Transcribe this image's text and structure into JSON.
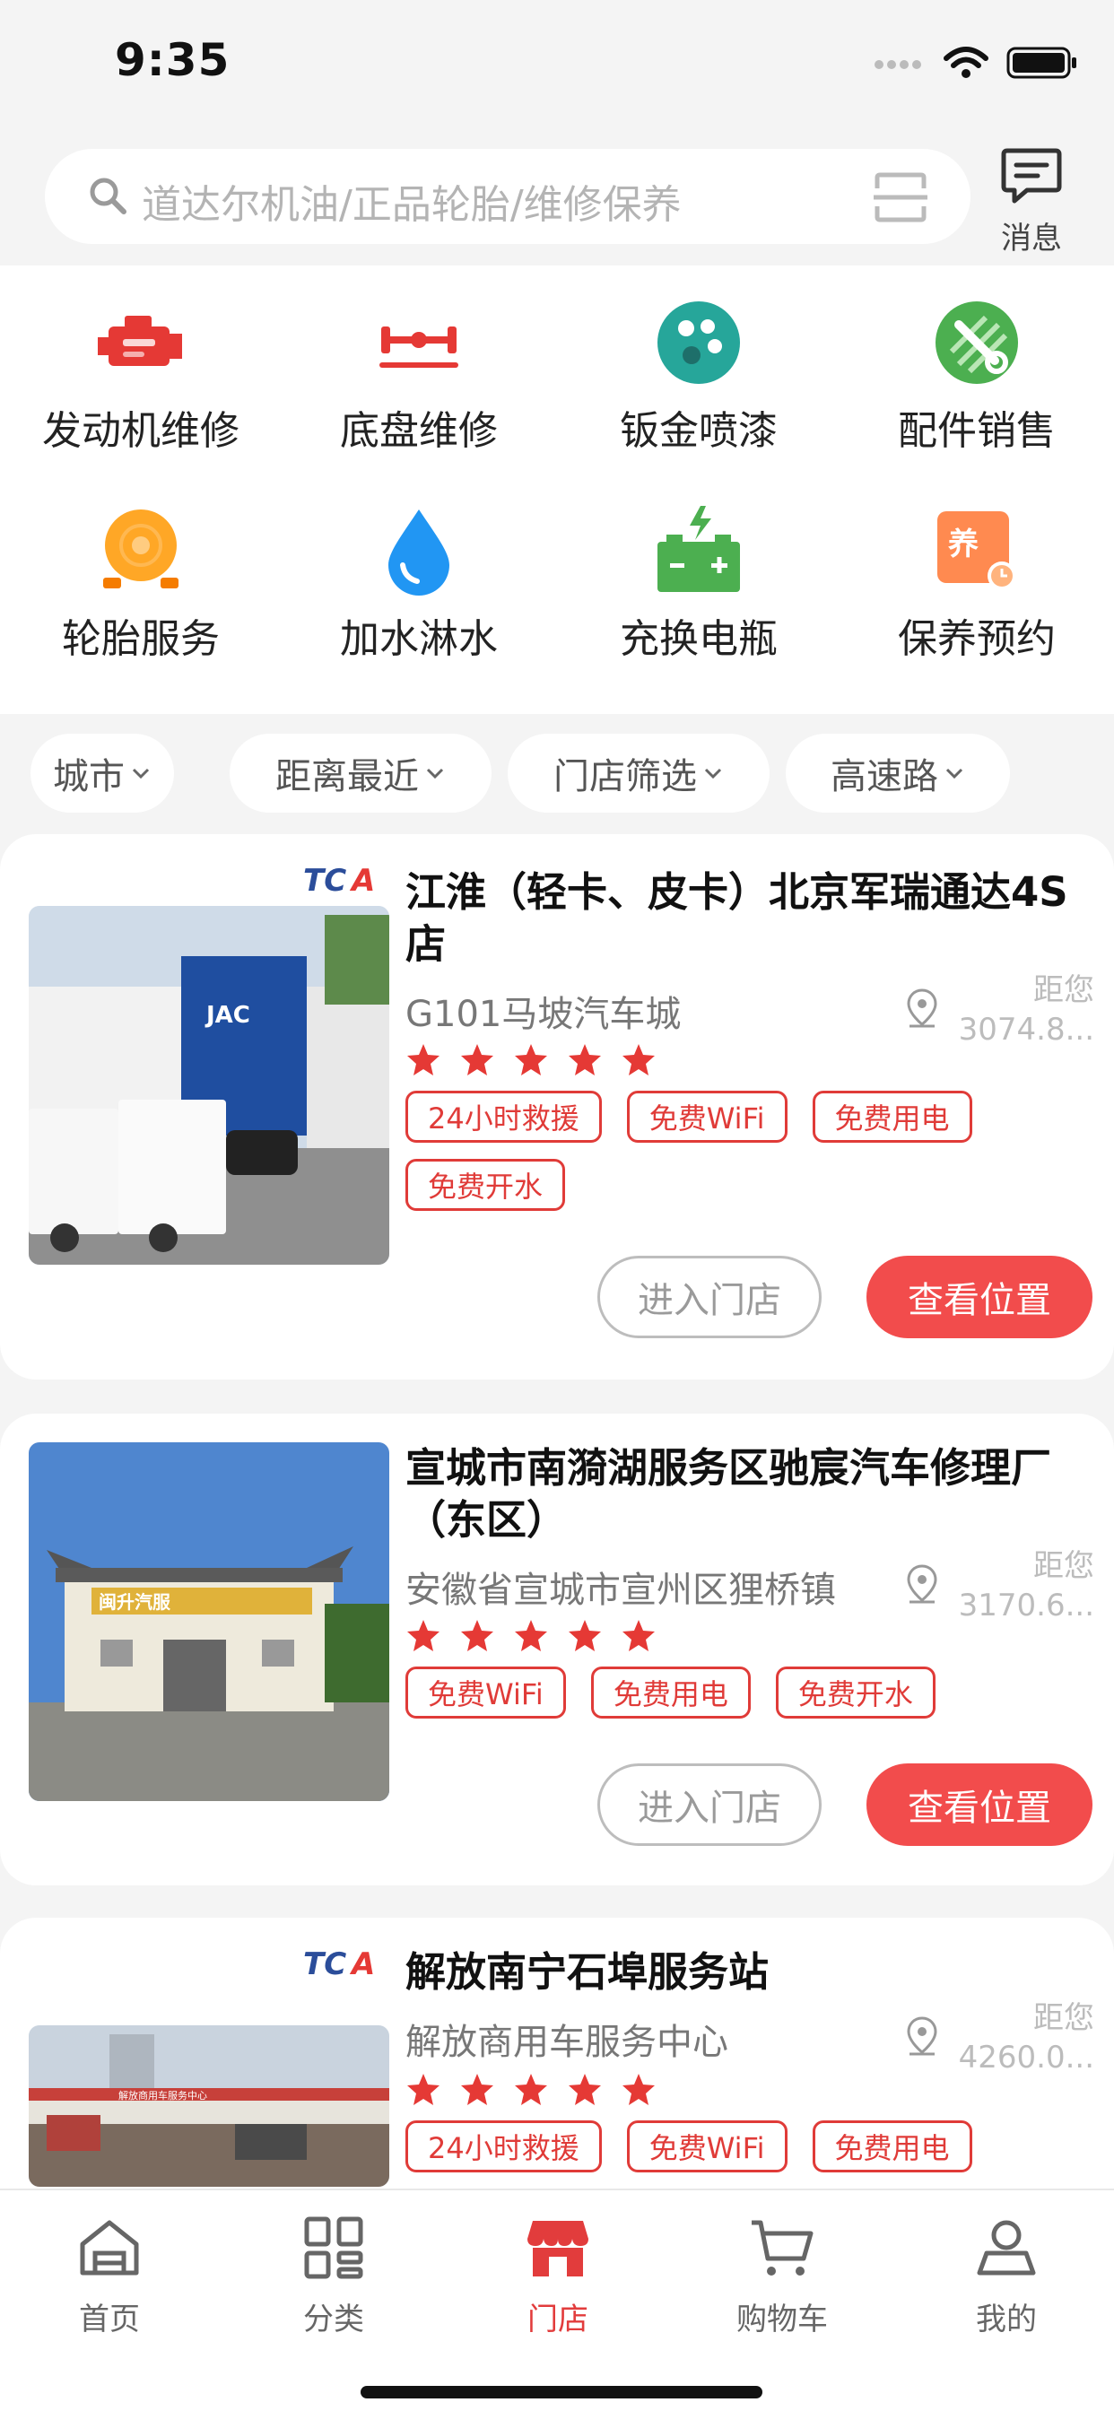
{
  "status": {
    "time": "9:35"
  },
  "search": {
    "placeholder": "道达尔机油/正品轮胎/维修保养"
  },
  "header": {
    "message_label": "消息"
  },
  "services": [
    {
      "label": "发动机维修",
      "icon": "engine-icon",
      "color": "#e53935"
    },
    {
      "label": "底盘维修",
      "icon": "chassis-icon",
      "color": "#e53935"
    },
    {
      "label": "钣金喷漆",
      "icon": "paint-palette-icon",
      "color": "#26a69a"
    },
    {
      "label": "配件销售",
      "icon": "parts-wrench-icon",
      "color": "#4caf50"
    },
    {
      "label": "轮胎服务",
      "icon": "tire-icon",
      "color": "#ffa726"
    },
    {
      "label": "加水淋水",
      "icon": "water-drop-icon",
      "color": "#2196f3"
    },
    {
      "label": "充换电瓶",
      "icon": "battery-icon",
      "color": "#4caf50"
    },
    {
      "label": "保养预约",
      "icon": "maintenance-booking-icon",
      "color": "#ff8a50"
    }
  ],
  "filters": [
    {
      "label": "城市"
    },
    {
      "label": "距离最近"
    },
    {
      "label": "门店筛选"
    },
    {
      "label": "高速路"
    }
  ],
  "stores": [
    {
      "badge": "TCA",
      "name": "江淮（轻卡、皮卡）北京军瑞通达4S店",
      "address": "G101马坡汽车城",
      "distance_label": "距您",
      "distance": "3074.8...",
      "rating": 5,
      "tags": [
        "24小时救援",
        "免费WiFi",
        "免费用电",
        "免费开水"
      ],
      "enter_label": "进入门店",
      "location_label": "查看位置",
      "image_sign": "JAC"
    },
    {
      "badge": "TCA",
      "name": "宣城市南漪湖服务区驰宸汽车修理厂（东区）",
      "address": "安徽省宣城市宣州区狸桥镇",
      "distance_label": "距您",
      "distance": "3170.6...",
      "rating": 5,
      "tags": [
        "免费WiFi",
        "免费用电",
        "免费开水"
      ],
      "enter_label": "进入门店",
      "location_label": "查看位置",
      "image_sign": "闽升汽服"
    },
    {
      "badge": "TCA",
      "name": "解放南宁石埠服务站",
      "address": "解放商用车服务中心",
      "distance_label": "距您",
      "distance": "4260.0...",
      "rating": 5,
      "tags": [
        "24小时救援",
        "免费WiFi",
        "免费用电"
      ],
      "image_sign": "解放商用车服务中心"
    }
  ],
  "tabbar": [
    {
      "label": "首页",
      "icon": "home-icon",
      "active": false
    },
    {
      "label": "分类",
      "icon": "category-grid-icon",
      "active": false
    },
    {
      "label": "门店",
      "icon": "store-icon",
      "active": true
    },
    {
      "label": "购物车",
      "icon": "cart-icon",
      "active": false
    },
    {
      "label": "我的",
      "icon": "profile-icon",
      "active": false
    }
  ],
  "colors": {
    "accent": "#f24c4c",
    "tag_red": "#e03b38",
    "background": "#f4f4f4"
  }
}
